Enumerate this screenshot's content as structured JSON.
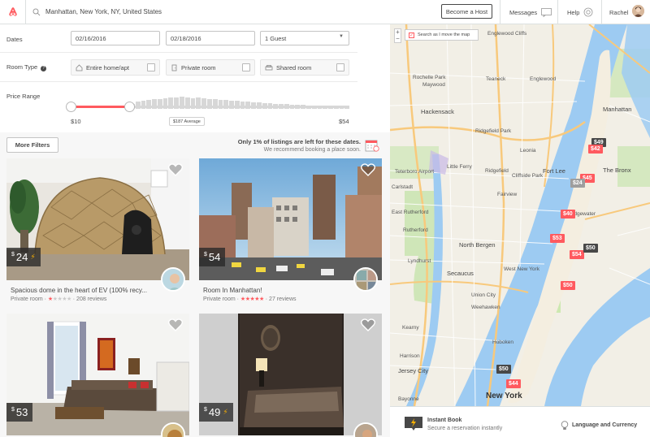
{
  "colors": {
    "brand": "#ff5a5f",
    "water": "#9dcbf2",
    "park": "#cde8b0",
    "highway": "#f8c97c"
  },
  "header": {
    "logo_icon": "airbnb-logo-icon",
    "search_value": "Manhattan, New York, NY, United States",
    "become_host": "Become a Host",
    "messages": "Messages",
    "help": "Help",
    "user_name": "Rachel"
  },
  "filters": {
    "dates_label": "Dates",
    "checkin": "02/16/2016",
    "checkout": "02/18/2016",
    "guests": "1 Guest",
    "room_type_label": "Room Type",
    "room_types": [
      {
        "label": "Entire home/apt",
        "icon": "home-icon",
        "checked": false
      },
      {
        "label": "Private room",
        "icon": "door-icon",
        "checked": false
      },
      {
        "label": "Shared room",
        "icon": "couch-icon",
        "checked": false
      }
    ],
    "price_range_label": "Price Range",
    "price_min": "$10",
    "price_max": "$54",
    "price_avg": "$187 Average",
    "more_filters": "More Filters",
    "notice_title": "Only 1% of listings are left for these dates.",
    "notice_sub": "We recommend booking a place soon."
  },
  "listings": [
    {
      "price": "24",
      "currency": "$",
      "instant": true,
      "title": "Spacious dome in the heart of EV (100% recy...",
      "type": "Private room",
      "rating": 1.5,
      "reviews": "208 reviews"
    },
    {
      "price": "54",
      "currency": "$",
      "instant": false,
      "title": "Room In Manhattan!",
      "type": "Private room",
      "rating": 5,
      "reviews": "27 reviews"
    },
    {
      "price": "53",
      "currency": "$",
      "instant": false,
      "title": "",
      "type": "",
      "rating": 0,
      "reviews": ""
    },
    {
      "price": "49",
      "currency": "$",
      "instant": true,
      "title": "",
      "type": "",
      "rating": 0,
      "reviews": ""
    }
  ],
  "map": {
    "search_as_move": "Search as I move the map",
    "zoom_in": "+",
    "zoom_out": "−",
    "labels": {
      "englewood_cliffs": "Englewood Cliffs",
      "rochelle_park": "Rochelle Park",
      "maywood": "Maywood",
      "teaneck": "Teaneck",
      "englewood": "Englewood",
      "hackensack": "Hackensack",
      "little_ferry": "Little Ferry",
      "ridgefield_park": "Ridgefield Park",
      "leonia": "Leonia",
      "teterboro": "Teterboro Airport",
      "carlstadt": "Carlstadt",
      "ridgefield": "Ridgefield",
      "fort_lee": "Fort Lee",
      "edgewater": "Edgewater",
      "fairview": "Fairview",
      "east_rutherford": "East Rutherford",
      "cliffside_park": "Cliffside Park",
      "rutherford": "Rutherford",
      "north_bergen": "North Bergen",
      "lyndhurst": "Lyndhurst",
      "secaucus": "Secaucus",
      "kearny": "Kearny",
      "west_new_york": "West New York",
      "union_city": "Union City",
      "weehawken": "Weehawken",
      "harrison": "Harrison",
      "hoboken": "Hoboken",
      "jersey_city": "Jersey City",
      "new_york": "New York",
      "bronx": "The Bronx",
      "bayonne": "Bayonne",
      "manhattan": "Manhattan"
    },
    "pins": [
      {
        "label": "$49",
        "style": "dark"
      },
      {
        "label": "$42",
        "style": "red"
      },
      {
        "label": "$45",
        "style": "red"
      },
      {
        "label": "$24",
        "style": "gray"
      },
      {
        "label": "$40",
        "style": "red"
      },
      {
        "label": "$53",
        "style": "red"
      },
      {
        "label": "$54",
        "style": "red"
      },
      {
        "label": "$50",
        "style": "dark"
      },
      {
        "label": "$50",
        "style": "red"
      },
      {
        "label": "$50",
        "style": "dark"
      },
      {
        "label": "$44",
        "style": "red"
      }
    ]
  },
  "footer": {
    "instant_book": "Instant Book",
    "instant_sub": "Secure a reservation instantly",
    "language": "Language and Currency"
  }
}
